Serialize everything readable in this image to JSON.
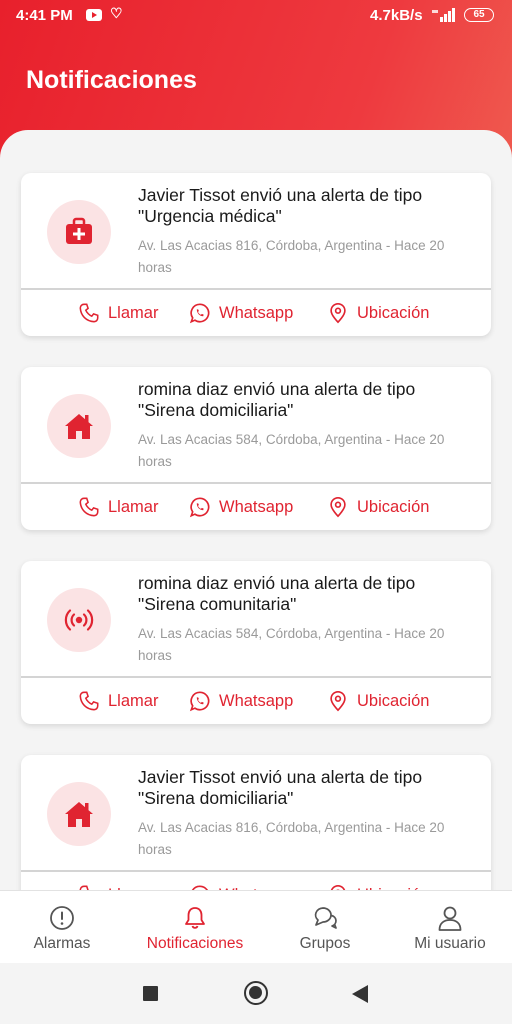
{
  "status_bar": {
    "time": "4:41 PM",
    "speed": "4.7kB/s",
    "battery": "65"
  },
  "header": {
    "title": "Notificaciones"
  },
  "colors": {
    "accent": "#e02431",
    "icon_bg": "#fbe3e4"
  },
  "notifications": [
    {
      "title": "Javier Tissot envió una alerta de tipo \"Urgencia médica\"",
      "subtitle": "Av. Las Acacias 816, Córdoba, Argentina - Hace 20 horas",
      "icon": "medical-kit-icon"
    },
    {
      "title": "romina diaz envió una alerta de tipo \"Sirena domiciliaria\"",
      "subtitle": "Av. Las Acacias 584, Córdoba, Argentina - Hace 20 horas",
      "icon": "house-icon"
    },
    {
      "title": "romina diaz envió una alerta de tipo \"Sirena comunitaria\"",
      "subtitle": "Av. Las Acacias 584, Córdoba, Argentina - Hace 20 horas",
      "icon": "broadcast-icon"
    },
    {
      "title": "Javier Tissot envió una alerta de tipo \"Sirena domiciliaria\"",
      "subtitle": "Av. Las Acacias 816, Córdoba, Argentina - Hace 20 horas",
      "icon": "house-icon"
    }
  ],
  "actions": {
    "call": "Llamar",
    "whatsapp": "Whatsapp",
    "location": "Ubicación"
  },
  "bottom_nav": {
    "items": [
      {
        "label": "Alarmas",
        "icon": "alert-circle-icon"
      },
      {
        "label": "Notificaciones",
        "icon": "bell-icon",
        "active": true
      },
      {
        "label": "Grupos",
        "icon": "chat-bubbles-icon"
      },
      {
        "label": "Mi usuario",
        "icon": "user-icon"
      }
    ]
  }
}
